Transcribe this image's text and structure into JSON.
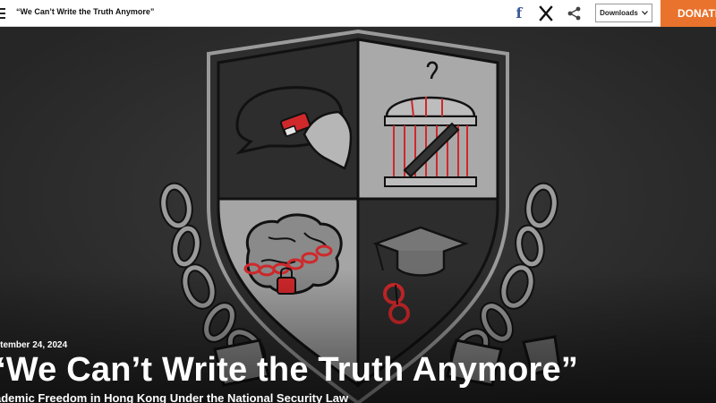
{
  "header": {
    "title": "“We Can’t Write the Truth Anymore”",
    "downloads_label": "Downloads",
    "donate_label": "DONATE",
    "icons": [
      "menu-icon",
      "facebook-icon",
      "x-icon",
      "share-icon",
      "chevron-down-icon"
    ]
  },
  "hero": {
    "date": "otember 24, 2024",
    "headline": "‘We Can’t Write the Truth Anymore”",
    "subtitle": "ademic Freedom in Hong Kong Under the National Security Law"
  },
  "colors": {
    "accent": "#e9722c",
    "illustration_red": "#d0282b",
    "facebook": "#3b5998",
    "background": "#2b2b2b"
  }
}
